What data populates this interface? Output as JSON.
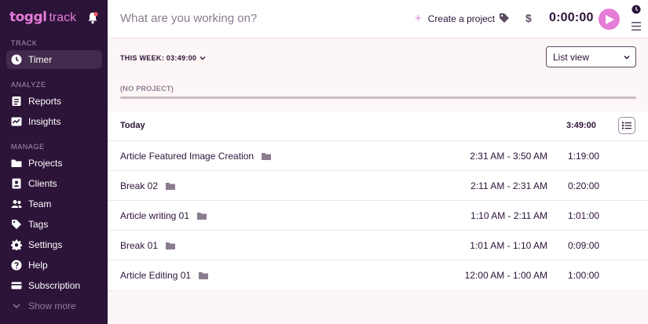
{
  "brand": {
    "name": "toggl",
    "product": "track"
  },
  "sidebar": {
    "sections": [
      {
        "label": "TRACK",
        "items": [
          {
            "label": "Timer",
            "icon": "clock-icon"
          }
        ]
      },
      {
        "label": "ANALYZE",
        "items": [
          {
            "label": "Reports",
            "icon": "reports-icon"
          },
          {
            "label": "Insights",
            "icon": "insights-icon"
          }
        ]
      },
      {
        "label": "MANAGE",
        "items": [
          {
            "label": "Projects",
            "icon": "folder-icon"
          },
          {
            "label": "Clients",
            "icon": "client-icon"
          },
          {
            "label": "Team",
            "icon": "team-icon"
          },
          {
            "label": "Tags",
            "icon": "tag-icon"
          },
          {
            "label": "Settings",
            "icon": "gear-icon"
          },
          {
            "label": "Help",
            "icon": "help-icon"
          },
          {
            "label": "Subscription",
            "icon": "card-icon"
          },
          {
            "label": "Show more",
            "icon": "chevron-down-icon"
          }
        ]
      }
    ],
    "active": "Timer"
  },
  "topbar": {
    "placeholder": "What are you working on?",
    "create_project": "Create a project",
    "timer": "0:00:00",
    "accent": "#e57cd8"
  },
  "summary": {
    "week_label": "THIS WEEK: 03:49:00",
    "view_select": "List view",
    "no_project": "(NO PROJECT)",
    "progress": 1.0
  },
  "day": {
    "label": "Today",
    "total": "3:49:00",
    "entries": [
      {
        "description": "Article Featured Image Creation",
        "range": "2:31 AM - 3:50 AM",
        "duration": "1:19:00"
      },
      {
        "description": "Break 02",
        "range": "2:11 AM - 2:31 AM",
        "duration": "0:20:00"
      },
      {
        "description": "Article writing 01",
        "range": "1:10 AM - 2:11 AM",
        "duration": "1:01:00"
      },
      {
        "description": "Break 01",
        "range": "1:01 AM - 1:10 AM",
        "duration": "0:09:00"
      },
      {
        "description": "Article Editing 01",
        "range": "12:00 AM - 1:00 AM",
        "duration": "1:00:00"
      }
    ]
  }
}
